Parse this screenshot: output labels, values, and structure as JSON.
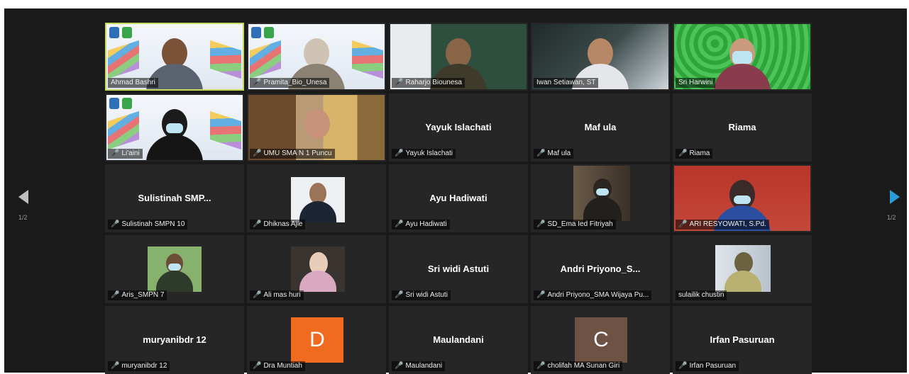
{
  "nav": {
    "prev_page": "1/2",
    "next_page": "1/2"
  },
  "tiles": [
    {
      "id": "ahmad",
      "label": "Ahmad Bashri",
      "mic_off": false,
      "active": true
    },
    {
      "id": "pramita",
      "label": "Pramita_Bio_Unesa",
      "mic_off": true
    },
    {
      "id": "raharjo",
      "label": "Raharjo Biounesa",
      "mic_off": true
    },
    {
      "id": "iwan",
      "label": "Iwan Setiawan, ST",
      "mic_off": false
    },
    {
      "id": "sri-harwini",
      "label": "Sri Harwini",
      "mic_off": false
    },
    {
      "id": "liaini",
      "label": "Li'aini",
      "mic_off": true
    },
    {
      "id": "umu",
      "label": "UMU SMA N 1 Puncu",
      "mic_off": true
    },
    {
      "id": "yayuk",
      "center": "Yayuk Islachati",
      "label": "Yayuk Islachati",
      "mic_off": true
    },
    {
      "id": "maf-ula",
      "center": "Maf ula",
      "label": "Maf ula",
      "mic_off": true
    },
    {
      "id": "riama",
      "center": "Riama",
      "label": "Riama",
      "mic_off": true
    },
    {
      "id": "sulistinah",
      "center": "Sulistinah  SMP...",
      "label": "Sulistinah SMPN 10",
      "mic_off": true
    },
    {
      "id": "dhiknas",
      "label": "Dhiknas Ajie",
      "mic_off": true
    },
    {
      "id": "ayu",
      "center": "Ayu Hadiwati",
      "label": "Ayu Hadiwati",
      "mic_off": true
    },
    {
      "id": "sd-ema",
      "label": "SD_Ema Ied Fitriyah",
      "mic_off": true
    },
    {
      "id": "ari",
      "label": "ARI RESYOWATI, S.Pd.",
      "mic_off": true
    },
    {
      "id": "aris",
      "label": "Aris_SMPN 7",
      "mic_off": true
    },
    {
      "id": "ali",
      "label": "Ali mas huri",
      "mic_off": true
    },
    {
      "id": "sri-widi",
      "center": "Sri widi Astuti",
      "label": "Sri widi Astuti",
      "mic_off": true
    },
    {
      "id": "andri",
      "center": "Andri  Priyono_S...",
      "label": "Andri Priyono_SMA Wijaya Pu...",
      "mic_off": true
    },
    {
      "id": "sulailik",
      "label": "sulailik chustin",
      "mic_off": false
    },
    {
      "id": "muryani",
      "center": "muryanibdr 12",
      "label": "muryanibdr 12",
      "mic_off": true
    },
    {
      "id": "dra",
      "avatar": "D",
      "avatar_color": "#f06a20",
      "label": "Dra Muntiah",
      "mic_off": true
    },
    {
      "id": "maulandani",
      "center": "Maulandani",
      "label": "Maulandani",
      "mic_off": true
    },
    {
      "id": "cholifah",
      "avatar": "C",
      "avatar_color": "#6e5344",
      "label": "cholifah MA Sunan Giri",
      "mic_off": true
    },
    {
      "id": "irfan",
      "center": "Irfan Pasuruan",
      "label": "Irfan Pasuruan",
      "mic_off": true
    }
  ]
}
